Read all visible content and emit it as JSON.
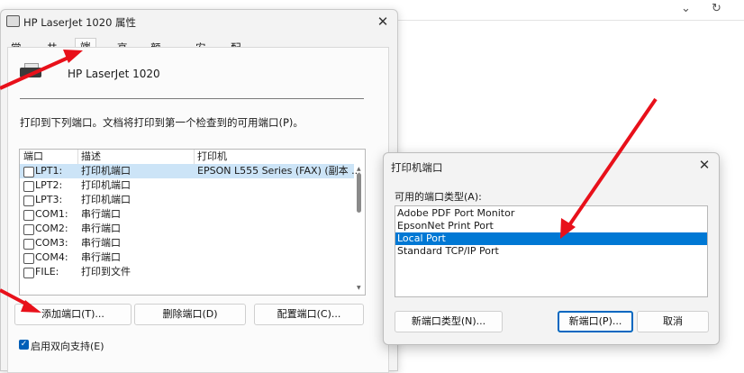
{
  "background": {
    "icons": [
      "chevron-down-icon",
      "refresh-icon"
    ]
  },
  "properties_dialog": {
    "title": "HP LaserJet 1020 属性",
    "tabs": [
      "常规",
      "共享",
      "端口",
      "高级",
      "颜色管理",
      "安全",
      "配置"
    ],
    "active_tab": "端口",
    "printer_name": "HP LaserJet 1020",
    "instruction": "打印到下列端口。文档将打印到第一个检查到的可用端口(P)。",
    "columns": [
      "端口",
      "描述",
      "打印机"
    ],
    "rows": [
      {
        "port": "LPT1:",
        "desc": "打印机端口",
        "printer": "EPSON L555 Series (FAX) (副本 ..."
      },
      {
        "port": "LPT2:",
        "desc": "打印机端口",
        "printer": ""
      },
      {
        "port": "LPT3:",
        "desc": "打印机端口",
        "printer": ""
      },
      {
        "port": "COM1:",
        "desc": "串行端口",
        "printer": ""
      },
      {
        "port": "COM2:",
        "desc": "串行端口",
        "printer": ""
      },
      {
        "port": "COM3:",
        "desc": "串行端口",
        "printer": ""
      },
      {
        "port": "COM4:",
        "desc": "串行端口",
        "printer": ""
      },
      {
        "port": "FILE:",
        "desc": "打印到文件",
        "printer": ""
      }
    ],
    "buttons": {
      "add": "添加端口(T)...",
      "delete": "删除端口(D)",
      "configure": "配置端口(C)..."
    },
    "bidirectional_label": "启用双向支持(E)",
    "bidirectional_checked": true
  },
  "ports_dialog": {
    "title": "打印机端口",
    "types_label": "可用的端口类型(A):",
    "types": [
      "Adobe PDF Port Monitor",
      "EpsonNet Print Port",
      "Local Port",
      "Standard TCP/IP Port"
    ],
    "selected_type": "Local Port",
    "buttons": {
      "new_type": "新端口类型(N)...",
      "new_port": "新端口(P)...",
      "cancel": "取消"
    }
  },
  "annotation_color": "#e8101a"
}
